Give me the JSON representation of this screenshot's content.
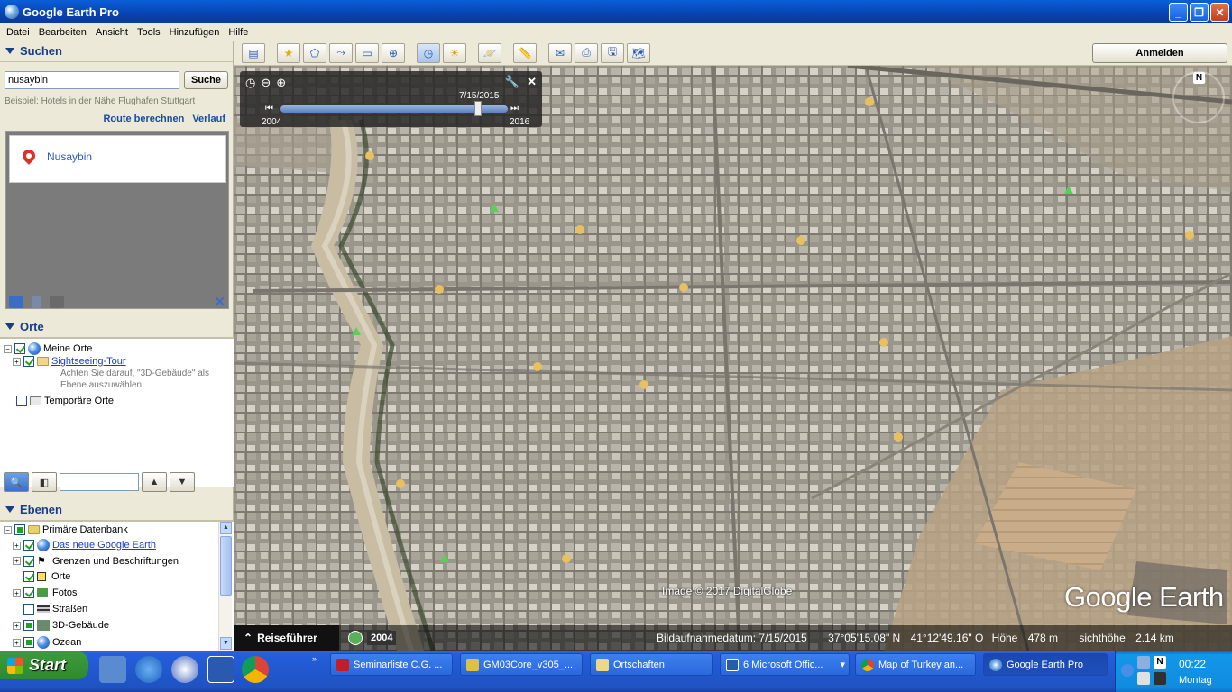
{
  "window": {
    "title": "Google Earth Pro"
  },
  "menu": [
    "Datei",
    "Bearbeiten",
    "Ansicht",
    "Tools",
    "Hinzufügen",
    "Hilfe"
  ],
  "search": {
    "header": "Suchen",
    "value": "nusaybin",
    "button": "Suche",
    "hint": "Beispiel: Hotels in der Nähe Flughafen Stuttgart",
    "route_link": "Route berechnen",
    "history_link": "Verlauf",
    "result": "Nusaybin"
  },
  "places": {
    "header": "Orte",
    "my_places": "Meine Orte",
    "sightseeing": "Sightseeing-Tour",
    "note_line1": "Achten Sie darauf, \"3D-Gebäude\" als",
    "note_line2": "Ebene auszuwählen",
    "temp_places": "Temporäre Orte"
  },
  "layers": {
    "header": "Ebenen",
    "primary_db": "Primäre Datenbank",
    "items": [
      "Das neue Google Earth",
      "Grenzen und Beschriftungen",
      "Orte",
      "Fotos",
      "Straßen",
      "3D-Gebäude",
      "Ozean"
    ]
  },
  "toolbar": {
    "login": "Anmelden"
  },
  "timeline": {
    "current_date": "7/15/2015",
    "start_year": "2004",
    "end_year": "2016",
    "position": 0.87
  },
  "map": {
    "credit": "Image © 2017 DigitalGlobe",
    "logo": "Google Earth",
    "compass_label": "N"
  },
  "statusbar": {
    "tour": "Reiseführer",
    "history_year": "2004",
    "image_date": "Bildaufnahmedatum: 7/15/2015",
    "lat": "37°05'15.08\" N",
    "lon": "41°12'49.16\" O",
    "elev_label": "Höhe",
    "elev_value": "478 m",
    "eye_label": "sichthöhe",
    "eye_value": "2.14 km"
  },
  "taskbar": {
    "start": "Start",
    "tasks": [
      "Seminarliste C.G. ...",
      "GM03Core_v305_...",
      "Ortschaften",
      "6 Microsoft Offic...",
      "Map of Turkey an...",
      "Google Earth Pro"
    ],
    "time": "00:22",
    "day": "Montag"
  },
  "colors": {
    "title_blue": "#0a5fd8",
    "link_blue": "#1a4aa0",
    "start_green": "#3c9b3c"
  }
}
